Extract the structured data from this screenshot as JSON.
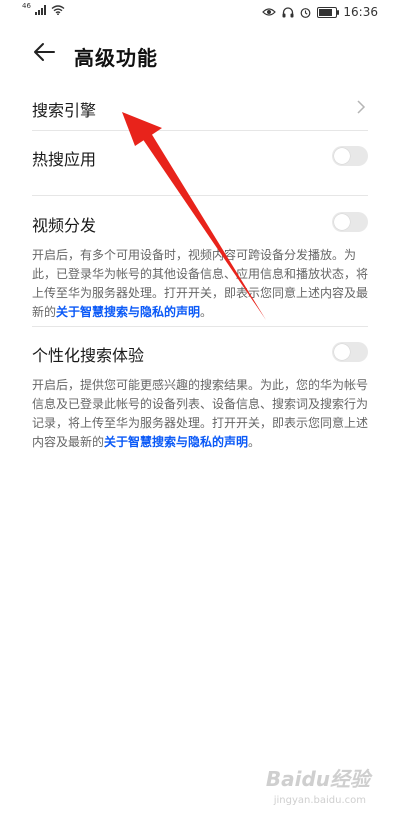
{
  "status_bar": {
    "signal_badge": "46",
    "time": "16:36",
    "icons": [
      "signal-icon",
      "wifi-icon",
      "eye-icon",
      "headphones-icon",
      "alarm-icon",
      "battery-icon"
    ]
  },
  "header": {
    "title": "高级功能",
    "back_icon": "back-arrow-icon"
  },
  "settings": {
    "search_engine": {
      "label": "搜索引擎"
    },
    "hot_search_apps": {
      "label": "热搜应用",
      "enabled": false
    },
    "video_distribution": {
      "label": "视频分发",
      "enabled": false,
      "description": "开启后，有多个可用设备时，视频内容可跨设备分发播放。为此，已登录华为帐号的其他设备信息、应用信息和播放状态，将上传至华为服务器处理。打开开关，即表示您同意上述内容及最新的",
      "link": "关于智慧搜索与隐私的声明",
      "suffix": "。"
    },
    "personalized_search": {
      "label": "个性化搜索体验",
      "enabled": false,
      "description": "开启后，提供您可能更感兴趣的搜索结果。为此，您的华为帐号信息及已登录此帐号的设备列表、设备信息、搜索词及搜索行为记录，将上传至华为服务器处理。打开开关，即表示您同意上述内容及最新的",
      "link": "关于智慧搜索与隐私的声明",
      "suffix": "。"
    }
  },
  "colors": {
    "accent_link": "#0a59f7",
    "annotation_arrow": "#e8231b",
    "toggle_off": "#e8e8e8"
  },
  "watermark": {
    "text": "Baidu经验",
    "sub": "jingyan.baidu.com"
  }
}
